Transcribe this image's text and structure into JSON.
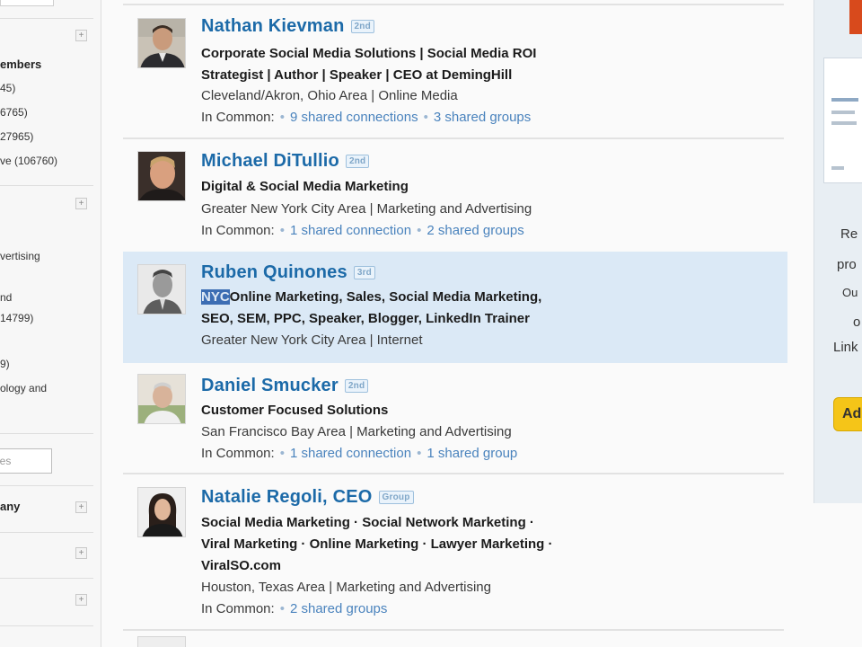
{
  "sidebar": {
    "lines": [
      {
        "text": "embers",
        "bold": true
      },
      {
        "text": "45)",
        "bold": false
      },
      {
        "text": "6765)",
        "bold": false
      },
      {
        "text": "27965)",
        "bold": false
      },
      {
        "text": "ve (106760)",
        "bold": false
      },
      {
        "text": "vertising",
        "bold": false
      },
      {
        "text": "nd",
        "bold": false
      },
      {
        "text": "14799)",
        "bold": false
      },
      {
        "text": "9)",
        "bold": false
      },
      {
        "text": "ology and",
        "bold": false
      },
      {
        "text": "any",
        "bold": true
      }
    ],
    "input_placeholder": "ies",
    "toggles": [
      "+",
      "+",
      "+",
      "+",
      "+"
    ]
  },
  "results": [
    {
      "name": "Nathan Kievman",
      "degree": "2nd",
      "headline_lines": [
        "Corporate Social Media Solutions | Social Media ROI",
        "Strategist | Author | Speaker | CEO at DemingHill"
      ],
      "location": "Cleveland/Akron, Ohio Area | Online Media",
      "in_common_label": "In Common:",
      "in_common_links": [
        "9 shared connections",
        "3 shared groups"
      ],
      "highlighted": false
    },
    {
      "name": "Michael DiTullio",
      "degree": "2nd",
      "headline_lines": [
        "Digital & Social Media Marketing"
      ],
      "location": "Greater New York City Area | Marketing and Advertising",
      "in_common_label": "In Common:",
      "in_common_links": [
        "1 shared connection",
        "2 shared groups"
      ],
      "highlighted": false
    },
    {
      "name": "Ruben Quinones",
      "degree": "3rd",
      "headline_selected": "NYC",
      "headline_lines": [
        "Online Marketing, Sales, Social Media Marketing,",
        "SEO, SEM, PPC, Speaker, Blogger, LinkedIn Trainer"
      ],
      "location": "Greater New York City Area | Internet",
      "in_common_label": "",
      "in_common_links": [],
      "highlighted": true
    },
    {
      "name": "Daniel Smucker",
      "degree": "2nd",
      "headline_lines": [
        "Customer Focused Solutions"
      ],
      "location": "San Francisco Bay Area | Marketing and Advertising",
      "in_common_label": "In Common:",
      "in_common_links": [
        "1 shared connection",
        "1 shared group"
      ],
      "highlighted": false
    },
    {
      "name": "Natalie Regoli, CEO",
      "degree": "Group",
      "headline_lines": [
        "Social Media Marketing · Social Network Marketing ·",
        "Viral Marketing · Online Marketing · Lawyer Marketing ·",
        "ViralSO.com"
      ],
      "location": "Houston, Texas Area | Marketing and Advertising",
      "in_common_label": "In Common:",
      "in_common_links": [
        "2 shared groups"
      ],
      "highlighted": false
    }
  ],
  "right_rail": {
    "texts": [
      "Re",
      "pro",
      "Ou",
      "o",
      "Link"
    ],
    "button_label": "Ad"
  },
  "colors": {
    "name_link": "#1c6aa8",
    "shared_link": "#4a83bd",
    "highlight_row": "#dbe9f6",
    "selection": "#3c6db3"
  }
}
